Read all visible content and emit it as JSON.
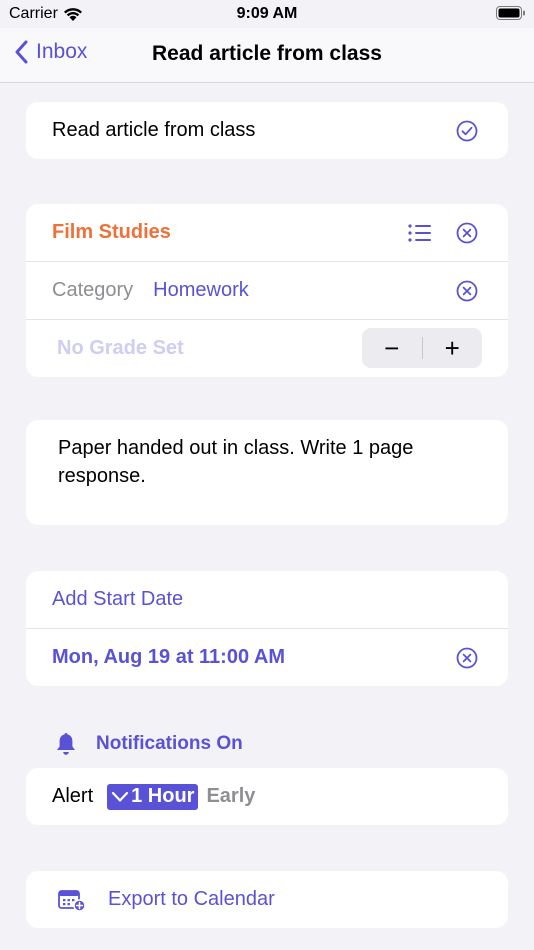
{
  "status_bar": {
    "carrier": "Carrier",
    "time": "9:09 AM"
  },
  "nav": {
    "back_label": "Inbox",
    "title": "Read article from class"
  },
  "task": {
    "title": "Read article from class"
  },
  "course": {
    "name": "Film Studies",
    "category_label": "Category",
    "category_value": "Homework",
    "grade_placeholder": "No Grade Set",
    "minus": "−",
    "plus": "+"
  },
  "notes": {
    "text": "Paper handed out in class. Write 1 page response."
  },
  "dates": {
    "start_label": "Add Start Date",
    "due": "Mon, Aug 19 at 11:00 AM"
  },
  "notifications": {
    "header": "Notifications On",
    "alert_label": "Alert",
    "lead_time": "1 Hour",
    "suffix": "Early"
  },
  "calendar": {
    "export_label": "Export to Calendar"
  },
  "colors": {
    "accent": "#5a52d6",
    "course": "#f0703a",
    "placeholder": "#cfcdf2"
  }
}
